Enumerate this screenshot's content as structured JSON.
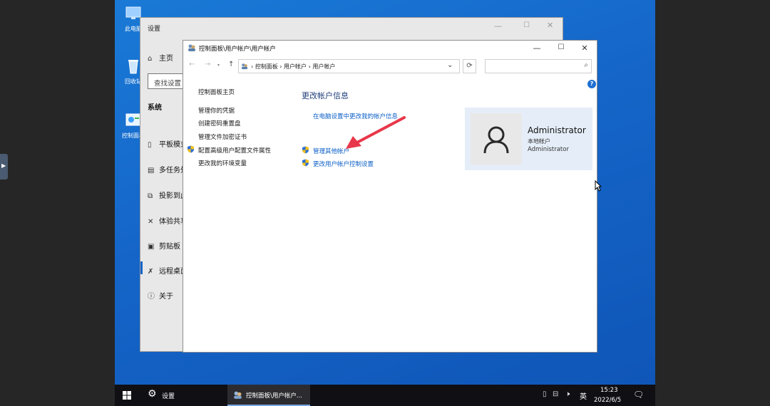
{
  "desktop": {
    "icons": [
      {
        "label": "此电脑",
        "icon": "computer-icon"
      },
      {
        "label": "回收站",
        "icon": "recycle-bin-icon"
      },
      {
        "label": "控制面板",
        "icon": "control-panel-icon"
      }
    ]
  },
  "settings": {
    "title": "设置",
    "home": "主页",
    "search_placeholder": "查找设置",
    "section": "系统",
    "nav": [
      {
        "label": "平板模式",
        "icon": "tablet-icon"
      },
      {
        "label": "多任务处理",
        "icon": "multitask-icon"
      },
      {
        "label": "投影到此电脑",
        "icon": "project-icon"
      },
      {
        "label": "体验共享",
        "icon": "share-icon"
      },
      {
        "label": "剪贴板",
        "icon": "clipboard-icon"
      },
      {
        "label": "远程桌面",
        "icon": "remote-desktop-icon"
      },
      {
        "label": "关于",
        "icon": "info-icon"
      }
    ]
  },
  "control_panel": {
    "title": "控制面板\\用户帐户\\用户帐户",
    "breadcrumb": [
      "控制面板",
      "用户帐户",
      "用户帐户"
    ],
    "left_nav": {
      "home": "控制面板主页",
      "items": [
        "管理你的凭据",
        "创建密码重置盘",
        "管理文件加密证书",
        "配置高级用户配置文件属性",
        "更改我的环境变量"
      ]
    },
    "main": {
      "heading": "更改帐户信息",
      "links": [
        "在电脑设置中更改我的帐户信息",
        "管理其他帐户",
        "更改用户帐户控制设置"
      ]
    },
    "account": {
      "name": "Administrator",
      "type": "本地帐户",
      "role": "Administrator"
    }
  },
  "taskbar": {
    "settings_label": "设置",
    "cp_label": "控制面板\\用户帐户...",
    "ime": "英",
    "time": "15:23",
    "date": "2022/6/5"
  },
  "colors": {
    "accent": "#1565c8",
    "link": "#0a5ec7",
    "arrow": "#e8374a",
    "account_bg": "#e5eef8"
  }
}
